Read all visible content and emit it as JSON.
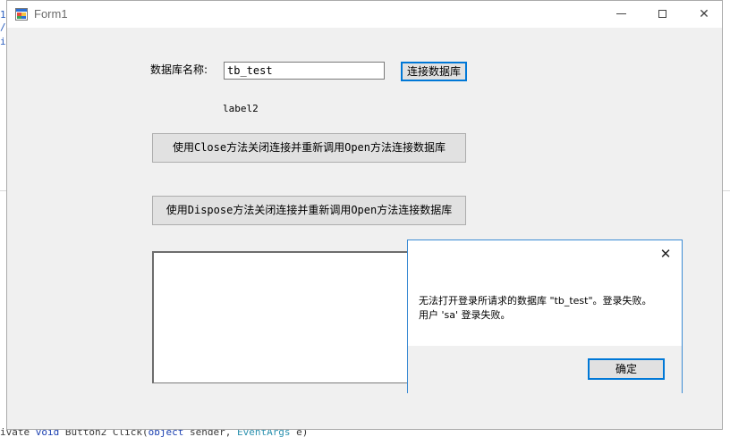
{
  "background": {
    "gutter_marks": [
      "1",
      "/",
      "i"
    ],
    "bottom_code": {
      "pre": "ivate ",
      "kw1": "void",
      "mid1": " Button2_Click(",
      "kw2": "object",
      "mid2": " sender, ",
      "type": "EventArgs",
      "post": " e)"
    }
  },
  "window": {
    "title": "Form1",
    "icon": "winforms-app-icon",
    "controls": {
      "close": "✕"
    }
  },
  "form": {
    "db_name_label": "数据库名称:",
    "db_name_value": "tb_test",
    "connect_button": "连接数据库",
    "label2": "label2",
    "close_reopen_button": "使用Close方法关闭连接并重新调用Open方法连接数据库",
    "dispose_reopen_button": "使用Dispose方法关闭连接并重新调用Open方法连接数据库",
    "output_text": ""
  },
  "dialog": {
    "close_glyph": "✕",
    "message_line1": "无法打开登录所请求的数据库 \"tb_test\"。登录失败。",
    "message_line2": "用户 'sa' 登录失败。",
    "ok_button": "确定"
  },
  "colors": {
    "accent": "#0078d7",
    "window_bg": "#f0f0f0",
    "button_bg": "#e1e1e1",
    "dialog_border": "#3c8bd4"
  }
}
